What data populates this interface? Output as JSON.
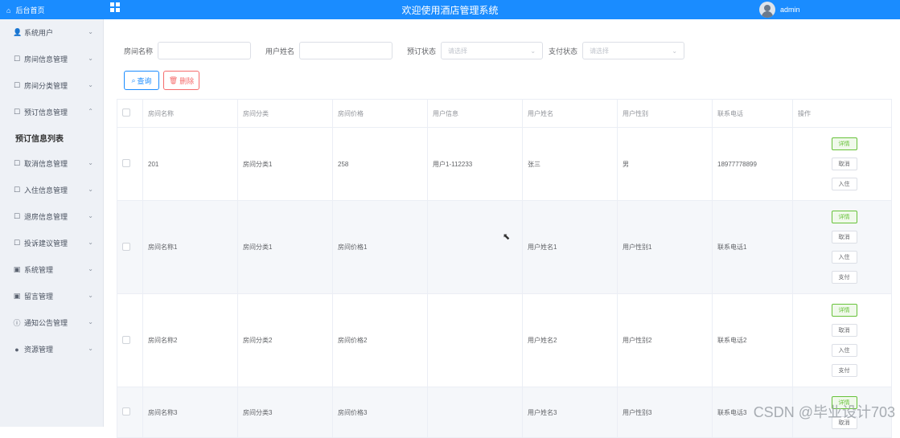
{
  "topbar": {
    "home_label": "后台首页",
    "home_icon": "home-icon",
    "title": "欢迎使用酒店管理系统",
    "username": "admin"
  },
  "sidebar": {
    "items": [
      {
        "label": "系统用户",
        "icon": "user-icon"
      },
      {
        "label": "房间信息管理",
        "icon": "doc-icon"
      },
      {
        "label": "房间分类管理",
        "icon": "doc-icon"
      },
      {
        "label": "预订信息管理",
        "icon": "doc-icon",
        "expanded": true
      },
      {
        "label": "取消信息管理",
        "icon": "doc-icon"
      },
      {
        "label": "入住信息管理",
        "icon": "doc-icon"
      },
      {
        "label": "退房信息管理",
        "icon": "doc-icon"
      },
      {
        "label": "投诉建议管理",
        "icon": "doc-icon"
      },
      {
        "label": "系统管理",
        "icon": "image-icon"
      },
      {
        "label": "留言管理",
        "icon": "image-icon"
      },
      {
        "label": "通知公告管理",
        "icon": "info-icon"
      },
      {
        "label": "资源管理",
        "icon": "pin-icon"
      }
    ],
    "sub_item": "预订信息列表"
  },
  "filters": {
    "room_name_label": "房间名称",
    "user_name_label": "用户姓名",
    "booking_status_label": "预订状态",
    "booking_status_placeholder": "请选择",
    "pay_status_label": "支付状态",
    "pay_status_placeholder": "请选择"
  },
  "buttons": {
    "query": "查询",
    "delete": "删除"
  },
  "table": {
    "headers": [
      "房间名称",
      "房间分类",
      "房间价格",
      "用户信息",
      "用户姓名",
      "用户性别",
      "联系电话",
      "操作"
    ],
    "rows": [
      {
        "cells": [
          "201",
          "房间分类1",
          "258",
          "用户1-112233",
          "张三",
          "男",
          "18977778899"
        ],
        "ops": [
          "详情",
          "取消",
          "入住"
        ]
      },
      {
        "cells": [
          "房间名称1",
          "房间分类1",
          "房间价格1",
          "",
          "用户姓名1",
          "用户性别1",
          "联系电话1"
        ],
        "ops": [
          "详情",
          "取消",
          "入住",
          "支付"
        ]
      },
      {
        "cells": [
          "房间名称2",
          "房间分类2",
          "房间价格2",
          "",
          "用户姓名2",
          "用户性别2",
          "联系电话2"
        ],
        "ops": [
          "详情",
          "取消",
          "入住",
          "支付"
        ]
      },
      {
        "cells": [
          "房间名称3",
          "房间分类3",
          "房间价格3",
          "",
          "用户姓名3",
          "用户性别3",
          "联系电话3"
        ],
        "ops": [
          "详情",
          "取消"
        ]
      }
    ]
  },
  "watermark": "CSDN @毕业设计703",
  "colors": {
    "primary": "#1a8cff",
    "danger": "#f56c6c",
    "success": "#67c23a"
  }
}
